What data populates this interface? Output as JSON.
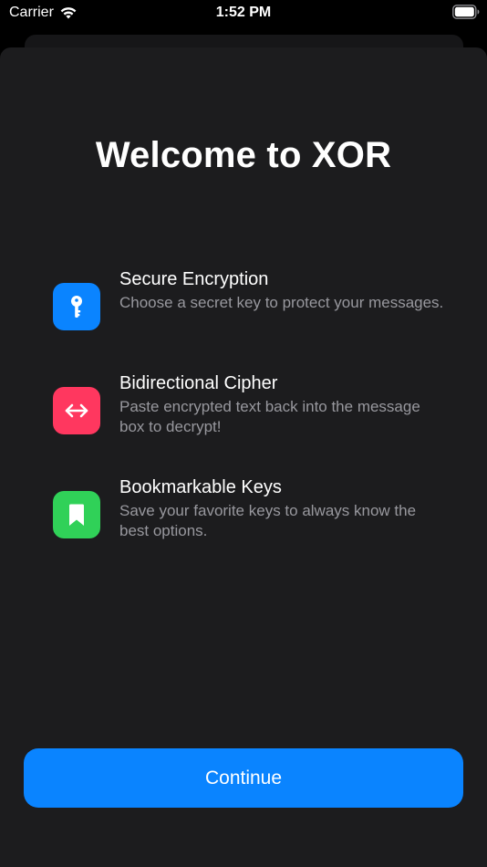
{
  "status_bar": {
    "carrier": "Carrier",
    "time": "1:52 PM",
    "wifi_icon": "wifi-icon",
    "battery_icon": "battery-icon"
  },
  "welcome": {
    "title": "Welcome to XOR"
  },
  "features": [
    {
      "title": "Secure Encryption",
      "description": "Choose a secret key to protect your messages.",
      "icon": "key-icon",
      "color": "#0a84ff"
    },
    {
      "title": "Bidirectional Cipher",
      "description": "Paste encrypted text back into the message box to decrypt!",
      "icon": "arrow-left-right-icon",
      "color": "#ff375f"
    },
    {
      "title": "Bookmarkable Keys",
      "description": "Save your favorite keys to always know the best options.",
      "icon": "bookmark-icon",
      "color": "#30d158"
    }
  ],
  "continue_button": {
    "label": "Continue",
    "color": "#0a84ff"
  },
  "colors": {
    "background": "#000000",
    "sheet": "#1c1c1e",
    "secondary_text": "#98989e"
  }
}
